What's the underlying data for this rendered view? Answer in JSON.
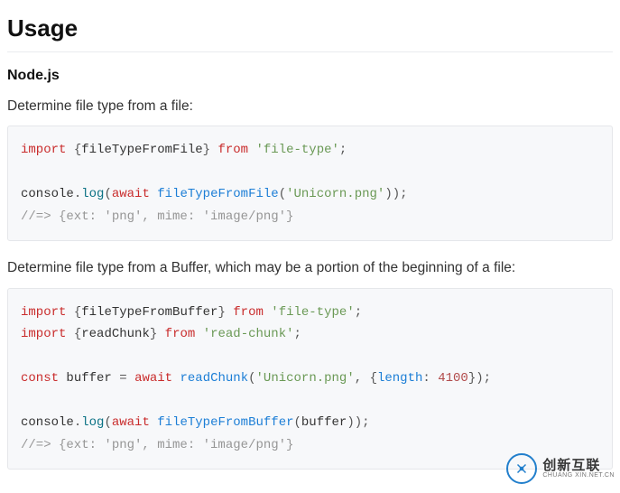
{
  "headings": {
    "usage": "Usage",
    "nodejs": "Node.js"
  },
  "paragraphs": {
    "p1": "Determine file type from a file:",
    "p2": "Determine file type from a Buffer, which may be a portion of the beginning of a file:"
  },
  "code1": {
    "line1": {
      "kw_import": "import",
      "brace_open": "{",
      "ident": "fileTypeFromFile",
      "brace_close": "}",
      "kw_from": "from",
      "str_open": "'",
      "str": "file-type",
      "str_close": "'",
      "semi": ";"
    },
    "line3": {
      "obj": "console",
      "dot": ".",
      "method": "log",
      "paren_open": "(",
      "kw_await": "await",
      "fn": "fileTypeFromFile",
      "paren_open2": "(",
      "str_open": "'",
      "str": "Unicorn.png",
      "str_close": "'",
      "paren_close2": ")",
      "paren_close": ")",
      "semi": ";"
    },
    "line4": {
      "comment": "//=> {ext: 'png', mime: 'image/png'}"
    }
  },
  "code2": {
    "line1": {
      "kw_import": "import",
      "brace_open": "{",
      "ident": "fileTypeFromBuffer",
      "brace_close": "}",
      "kw_from": "from",
      "str_open": "'",
      "str": "file-type",
      "str_close": "'",
      "semi": ";"
    },
    "line2": {
      "kw_import": "import",
      "brace_open": "{",
      "ident": "readChunk",
      "brace_close": "}",
      "kw_from": "from",
      "str_open": "'",
      "str": "read-chunk",
      "str_close": "'",
      "semi": ";"
    },
    "line4": {
      "kw_const": "const",
      "ident": "buffer",
      "eq": "=",
      "kw_await": "await",
      "fn": "readChunk",
      "paren_open": "(",
      "str_open": "'",
      "str": "Unicorn.png",
      "str_close": "'",
      "comma": ",",
      "brace_open": "{",
      "prop": "length",
      "colon": ":",
      "num": "4100",
      "brace_close": "}",
      "paren_close": ")",
      "semi": ";"
    },
    "line6": {
      "obj": "console",
      "dot": ".",
      "method": "log",
      "paren_open": "(",
      "kw_await": "await",
      "fn": "fileTypeFromBuffer",
      "paren_open2": "(",
      "arg": "buffer",
      "paren_close2": ")",
      "paren_close": ")",
      "semi": ";"
    },
    "line7": {
      "comment": "//=> {ext: 'png', mime: 'image/png'}"
    }
  },
  "watermark": {
    "brand": "创新互联",
    "tagline": "CHUANG XIN.NET.CN"
  }
}
